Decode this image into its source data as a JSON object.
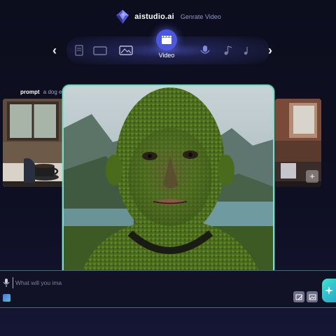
{
  "header": {
    "brand": "aistudio.ai",
    "subtitle": "Genrate Video",
    "logo_icon": "diamond-gem-logo"
  },
  "mode_carousel": {
    "active_mode": "Video",
    "active_icon": "clapperboard-icon",
    "other_modes_icons": [
      "document-icon",
      "slides-icon",
      "image-icon",
      "microphone-icon",
      "music-note-icon",
      "music-note-alt-icon"
    ],
    "prev_arrow": "‹",
    "next_arrow": "›"
  },
  "prompt": {
    "label": "prompt",
    "value": "a dog eat"
  },
  "gallery": {
    "side_left_icon": "coffee-cup-scene",
    "side_right_icon": "cafe-scene",
    "add_label": "+"
  },
  "input_bar": {
    "placeholder": "What will you imag",
    "mic_icon": "microphone-icon",
    "attach_icon": "gradient-attach-icon",
    "tool_icons": [
      "edit-image-icon",
      "image-icon"
    ],
    "generate_icon": "sparkle-icon"
  },
  "colors": {
    "background": "#0b0c1a",
    "accent": "#4b56e2",
    "card_border": "#7be0c8",
    "generate": "#3fe0cf",
    "moss_green": "#4c6a1e"
  }
}
